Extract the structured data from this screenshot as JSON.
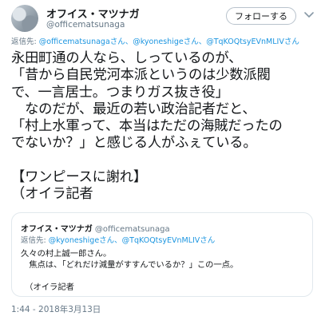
{
  "author": {
    "display_name": "オフイス・マツナガ",
    "handle": "@officematsunaga",
    "follow_button": "フォローする"
  },
  "reply_to": {
    "prefix": "返信先: ",
    "users": "@officematsunagaさん、@kyoneshigeさん、@TqKOQtsyEVnMLIVさん"
  },
  "tweet": {
    "lines": [
      "永田町通の人なら、しっているのが、",
      "「昔から自民党河本派というのは少数派閥",
      "で、一言居士。つまりガス抜き役」",
      "　なのだが、最近の若い政治記者だと、",
      "「村上水軍って、本当はただの海賊だったの",
      "でないか？」と感じる人がふぇている。",
      "",
      "【ワンピースに謝れ】",
      "（オイラ記者"
    ]
  },
  "quoted": {
    "display_name": "オフイス・マツナガ",
    "handle": "@officematsunaga",
    "reply_prefix": "返信先: ",
    "reply_users": "@kyoneshigeさん、@TqKOQtsyEVnMLIVさん",
    "lines": [
      "久々の村上誠一郎さん。",
      "　焦点は、「どれだけ減量がすすんでいるか？」この一点。",
      "",
      "　（オイラ記者"
    ]
  },
  "timestamp": "1:44 - 2018年3月13日",
  "icons": {
    "avatar": "profile-photo",
    "menu": "chevron-down-icon"
  },
  "colors": {
    "link": "#1b95e0",
    "secondary_text": "#657786",
    "border": "#e1e8ed"
  }
}
